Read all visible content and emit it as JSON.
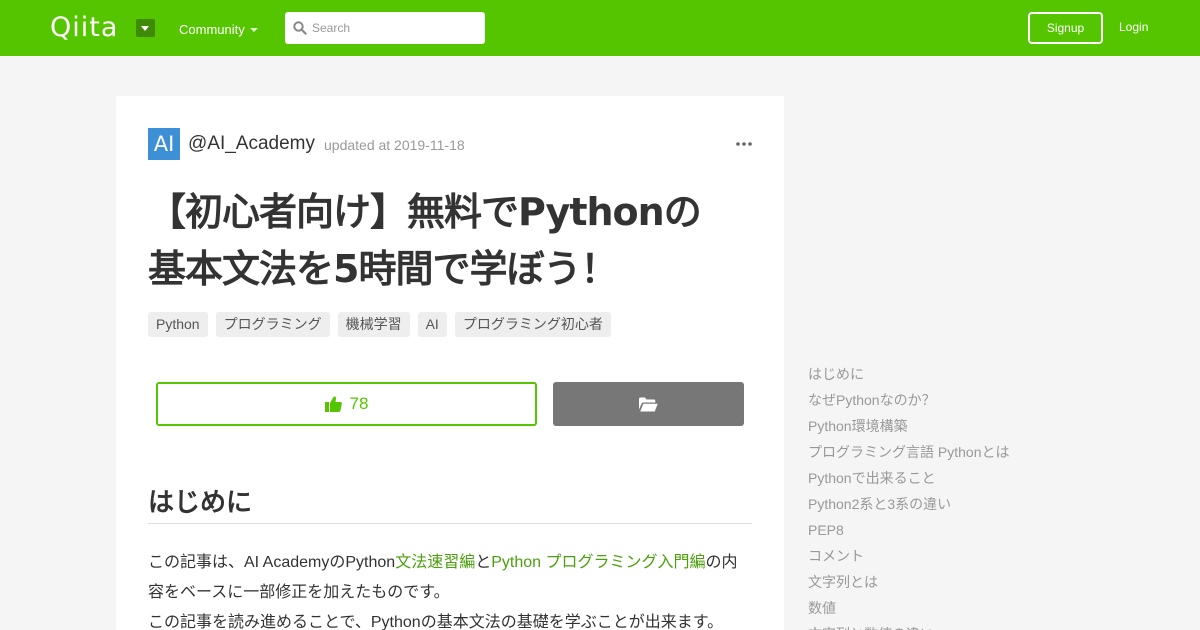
{
  "header": {
    "logo": "Qiita",
    "community_label": "Community",
    "search_placeholder": "Search",
    "signup_label": "Signup",
    "login_label": "Login"
  },
  "article": {
    "avatar_text": "AI",
    "username": "@AI_Academy",
    "updated": "updated at 2019-11-18",
    "title_line1": "【初心者向け】無料でPythonの",
    "title_line2": "基本文法を5時間で学ぼう！",
    "tags": [
      "Python",
      "プログラミング",
      "機械学習",
      "AI",
      "プログラミング初心者"
    ],
    "like_count": "78",
    "section_heading": "はじめに",
    "paragraph": {
      "p1_pre": "この記事は、AI AcademyのPython",
      "link1": "文法速習編",
      "p1_mid": "と",
      "link2": "Python プログラミング入門編",
      "p1_post": "の内容をベースに一部修正を加えたものです。",
      "p2": "この記事を読み進めることで、Pythonの基本文法の基礎を学ぶことが出来ます。"
    }
  },
  "toc": [
    "はじめに",
    "なぜPythonなのか？",
    "Python環境構築",
    "プログラミング言語 Pythonとは",
    "Pythonで出来ること",
    "Python2系と3系の違い",
    "PEP8",
    "コメント",
    "文字列とは",
    "数値",
    "文字列と数値の違い"
  ],
  "colors": {
    "brand_green": "#55c500",
    "link_green": "#4ba00d",
    "avatar_blue": "#3d8fd6"
  }
}
